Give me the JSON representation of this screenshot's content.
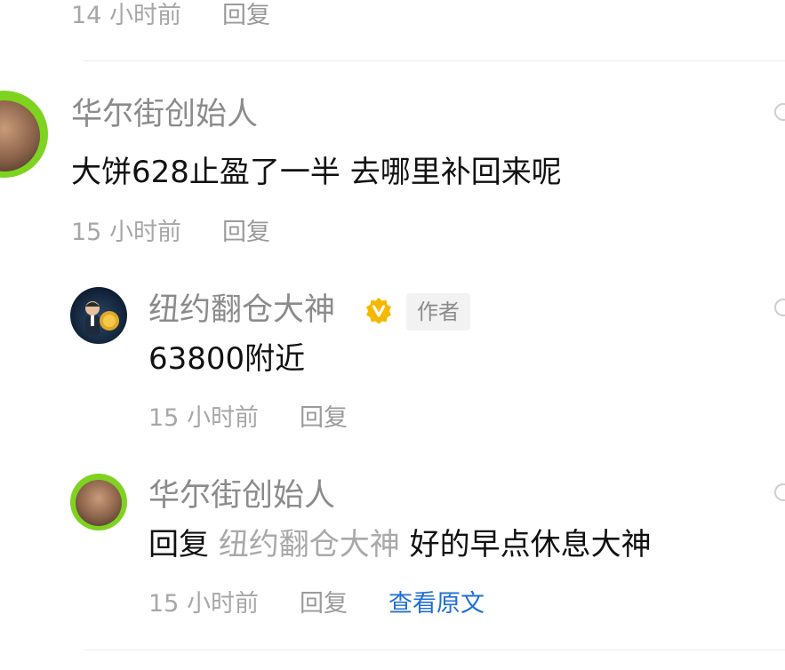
{
  "top_item": {
    "time": "14 小时前",
    "reply_label": "回复"
  },
  "comment1": {
    "username": "华尔街创始人",
    "text": "大饼628止盈了一半 去哪里补回来呢",
    "time": "15 小时前",
    "reply_label": "回复"
  },
  "reply1": {
    "username": "纽约翻仓大神",
    "author_tag": "作者",
    "text": "63800附近",
    "time": "15 小时前",
    "reply_label": "回复"
  },
  "reply2": {
    "username": "华尔街创始人",
    "prefix": "回复",
    "mention": "纽约翻仓大神",
    "text": "好的早点休息大神",
    "time": "15 小时前",
    "reply_label": "回复",
    "view_original_label": "查看原文"
  },
  "colors": {
    "link": "#1f6fd6",
    "avatar_green": "#7ed321",
    "verified_gold": "#f5b800",
    "meta_gray": "#a7a7a7"
  },
  "icons": {
    "verified": "verified-badge-icon",
    "more": "more-dot-icon"
  }
}
